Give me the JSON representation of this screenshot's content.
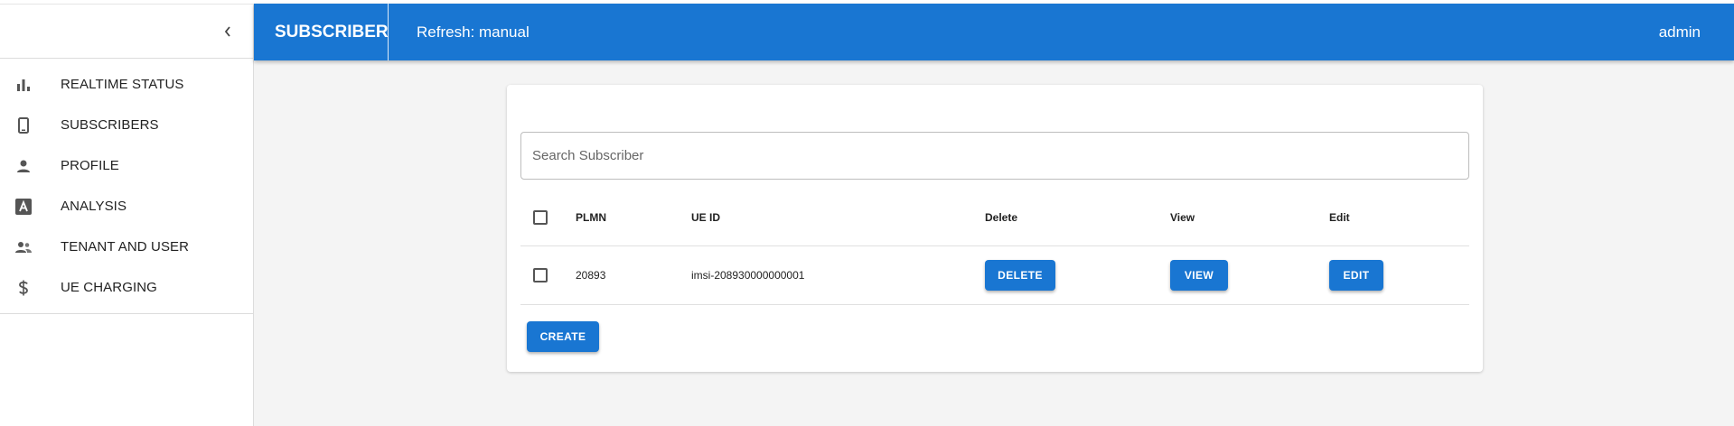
{
  "sidebar": {
    "items": [
      {
        "label": "REALTIME STATUS",
        "icon": "bar-chart-icon"
      },
      {
        "label": "SUBSCRIBERS",
        "icon": "phone-icon"
      },
      {
        "label": "PROFILE",
        "icon": "person-icon"
      },
      {
        "label": "ANALYSIS",
        "icon": "analysis-icon"
      },
      {
        "label": "TENANT AND USER",
        "icon": "people-icon"
      },
      {
        "label": "UE CHARGING",
        "icon": "dollar-icon"
      }
    ]
  },
  "appbar": {
    "title": "SUBSCRIBER",
    "refresh": "Refresh: manual",
    "user": "admin",
    "color": "#1976d2"
  },
  "search": {
    "placeholder": "Search Subscriber",
    "value": ""
  },
  "table": {
    "headers": {
      "plmn": "PLMN",
      "ueid": "UE ID",
      "delete": "Delete",
      "view": "View",
      "edit": "Edit"
    },
    "rows": [
      {
        "plmn": "20893",
        "ueid": "imsi-208930000000001",
        "delete": "DELETE",
        "view": "VIEW",
        "edit": "EDIT"
      }
    ]
  },
  "create_label": "CREATE"
}
